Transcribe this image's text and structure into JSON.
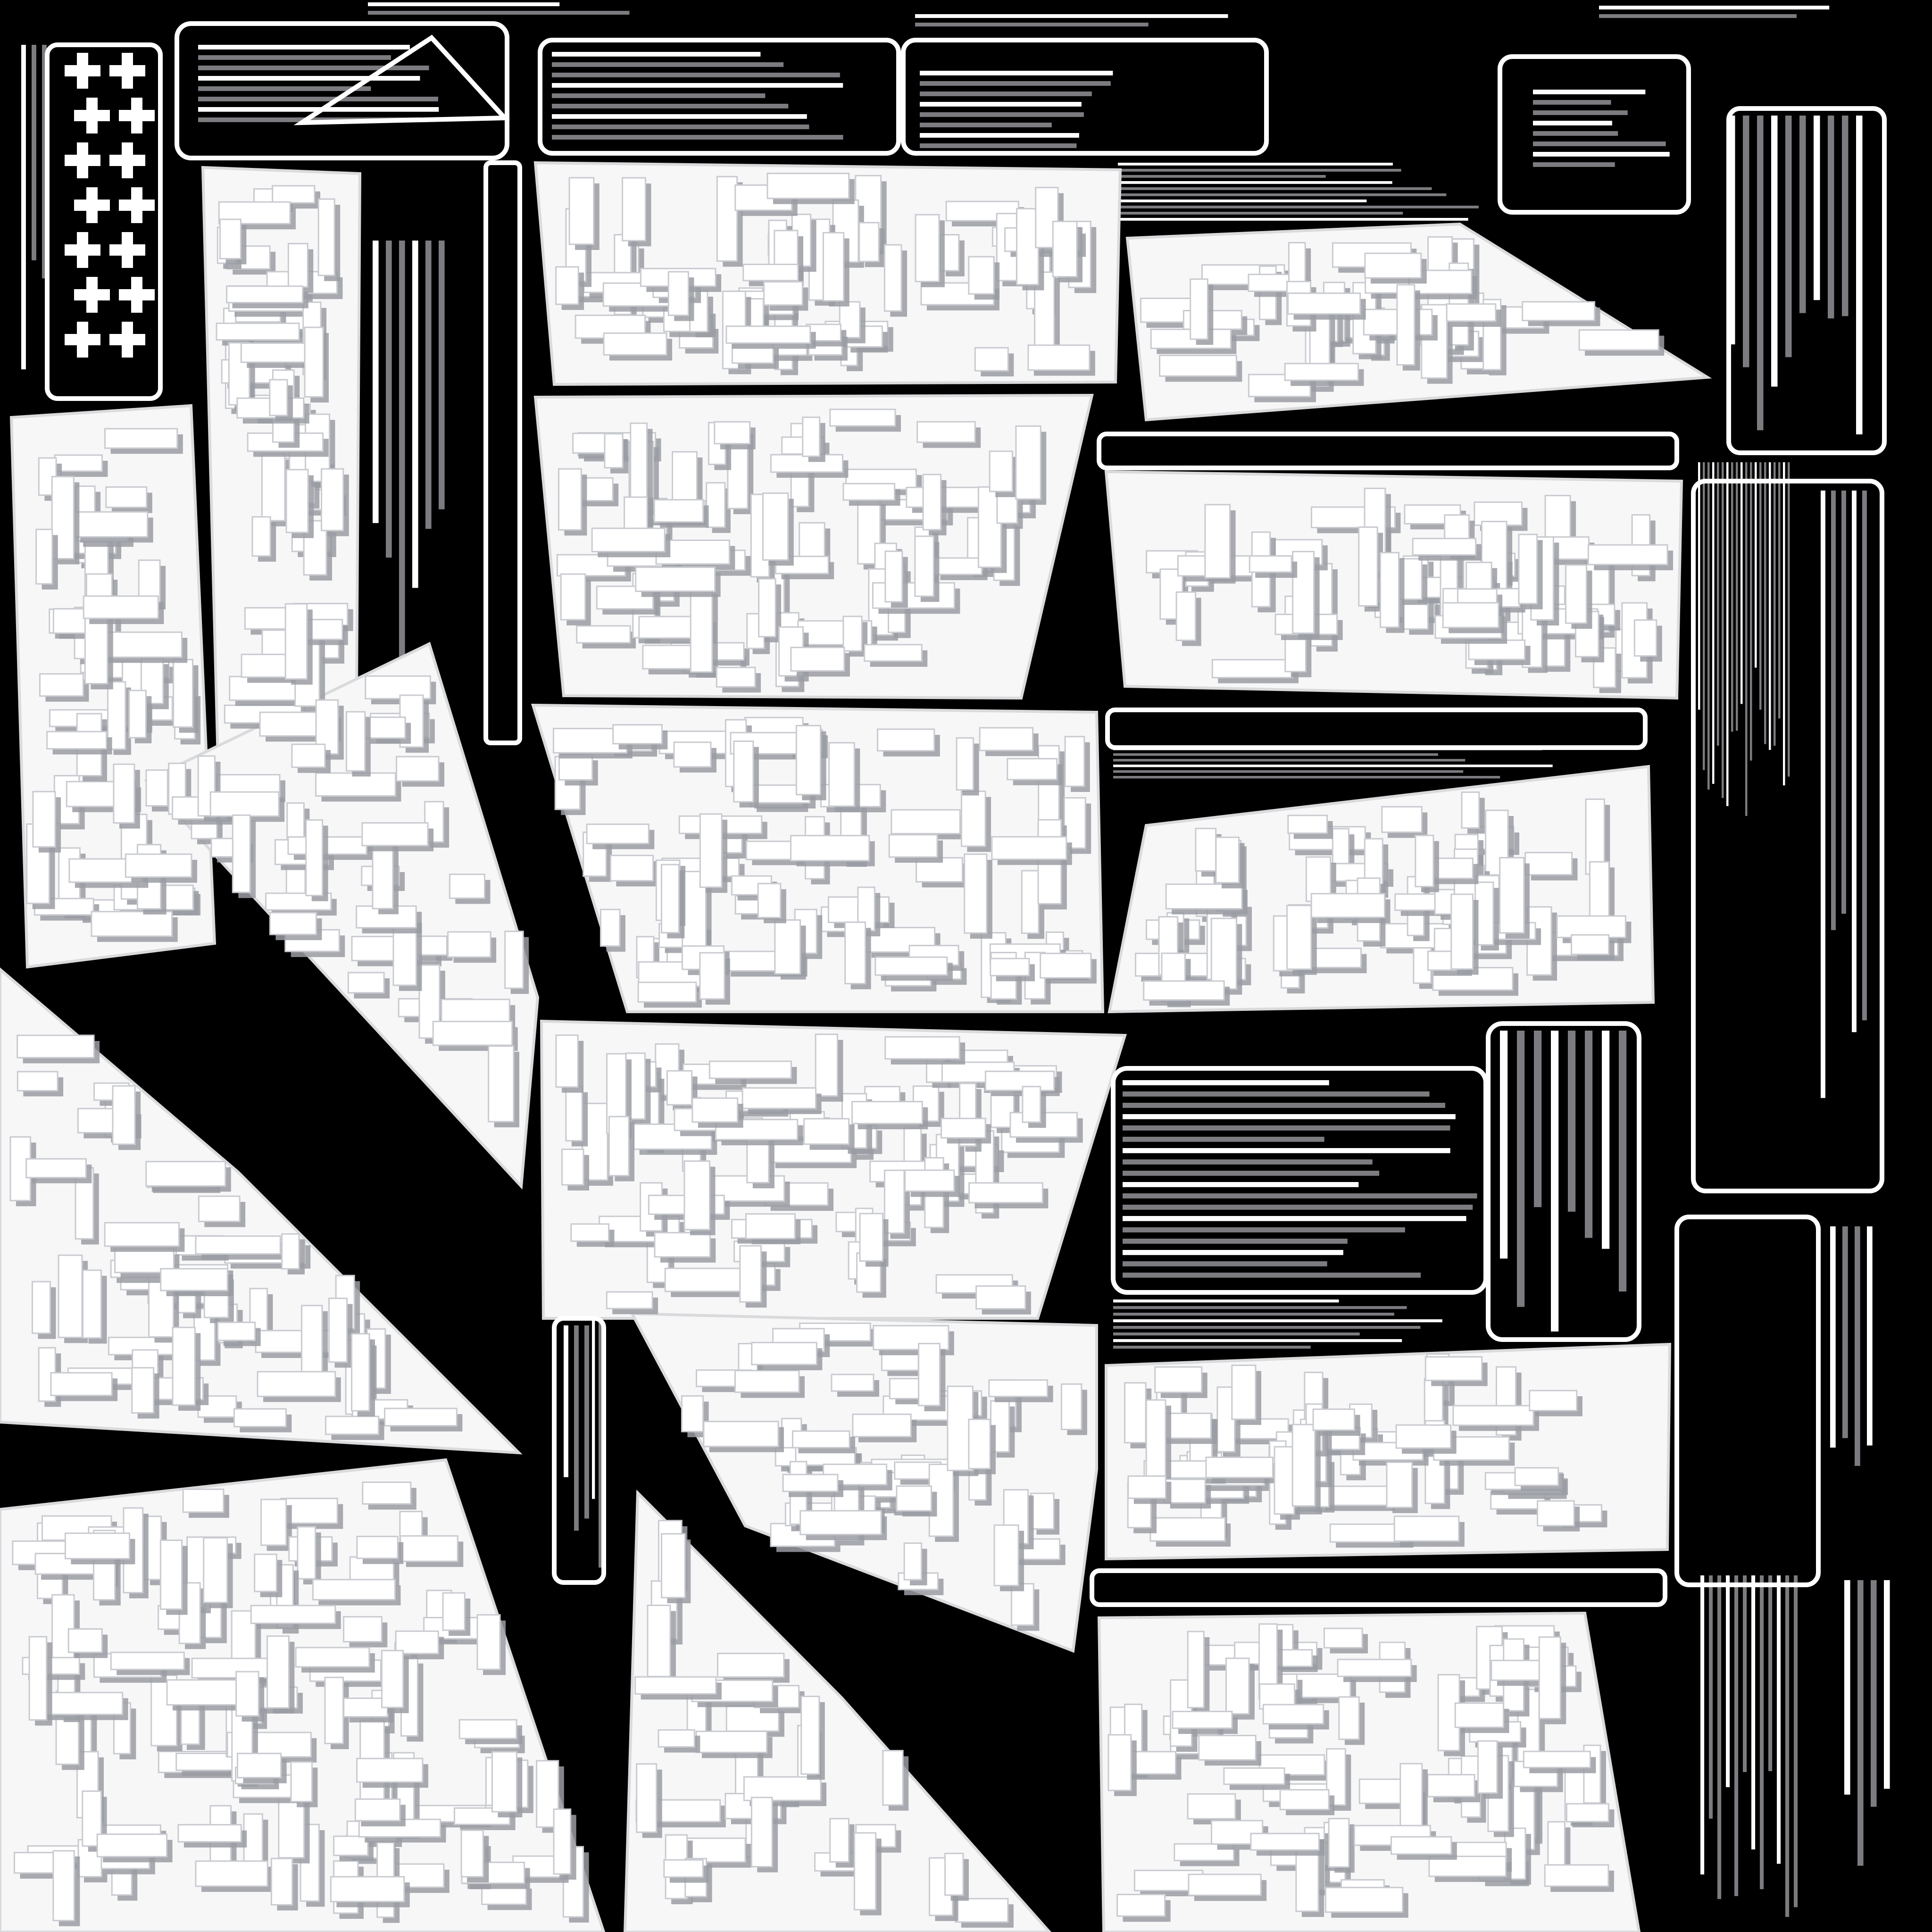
{
  "texture": {
    "background_color": "#000000",
    "panel_color": "#f7f7f8",
    "panel_edge_color": "#d9dadc",
    "block_shadow_color": "#9a9ca3",
    "block_face_color": "#ffffff",
    "strip_color": "#ffffff",
    "strip_dim_color": "#7c7c80",
    "island_count": 24
  }
}
